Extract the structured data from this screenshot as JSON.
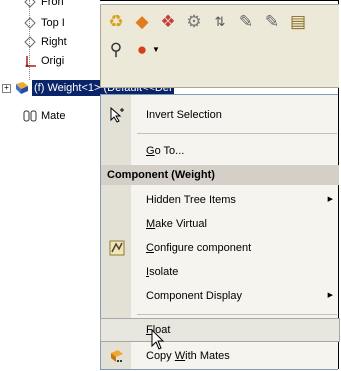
{
  "tree": {
    "items": [
      {
        "label": "Fron",
        "icon": "plane-icon"
      },
      {
        "label": "Top I",
        "icon": "plane-icon"
      },
      {
        "label": "Right",
        "icon": "plane-icon"
      },
      {
        "label": "Origi",
        "icon": "origin-icon"
      },
      {
        "label": "(f) Weight<1> (Default<<Def",
        "icon": "component-icon"
      },
      {
        "label": "Mate",
        "icon": "mates-icon"
      }
    ]
  },
  "toolbar": {
    "icons": [
      "open-part-icon",
      "assembly-icon",
      "component-properties-icon",
      "configurations-icon",
      "reorder-icon",
      "edit-icon",
      "sketch-icon",
      "document-icon",
      "zoom-icon",
      "appearance-icon"
    ]
  },
  "menu": {
    "invert_selection": "Invert Selection",
    "go_to_prefix": "G",
    "go_to_rest": "o To...",
    "header": "Component (Weight)",
    "hidden_tree_items": "Hidden Tree Items",
    "make_virtual_prefix": "M",
    "make_virtual_rest": "ake Virtual",
    "configure_prefix": "C",
    "configure_rest": "onfigure component",
    "isolate_prefix": "I",
    "isolate_rest": "solate",
    "component_display": "Component Display",
    "float_prefix": "F",
    "float_rest": "loat",
    "copy_mates_a": "Copy",
    "copy_mates_w": "W",
    "copy_mates_b": "ith Mates"
  }
}
